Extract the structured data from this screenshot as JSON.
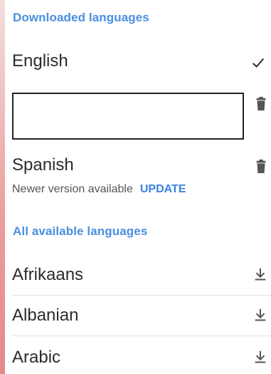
{
  "downloaded_section": {
    "title": "Downloaded languages",
    "items": [
      {
        "name": "English",
        "status": "selected",
        "icon": "check-icon"
      },
      {
        "name": "",
        "status": "editing",
        "icon": "trash-icon"
      },
      {
        "name": "Spanish",
        "subtitle": "Newer version available",
        "action": "UPDATE",
        "icon": "trash-icon"
      }
    ]
  },
  "available_section": {
    "title": "All available languages",
    "items": [
      {
        "name": "Afrikaans",
        "icon": "download-icon"
      },
      {
        "name": "Albanian",
        "icon": "download-icon"
      },
      {
        "name": "Arabic",
        "icon": "download-icon"
      }
    ]
  },
  "colors": {
    "accent": "#4a8fe0",
    "text": "#212121",
    "icon": "#555555",
    "divider": "#e2e2e2"
  }
}
